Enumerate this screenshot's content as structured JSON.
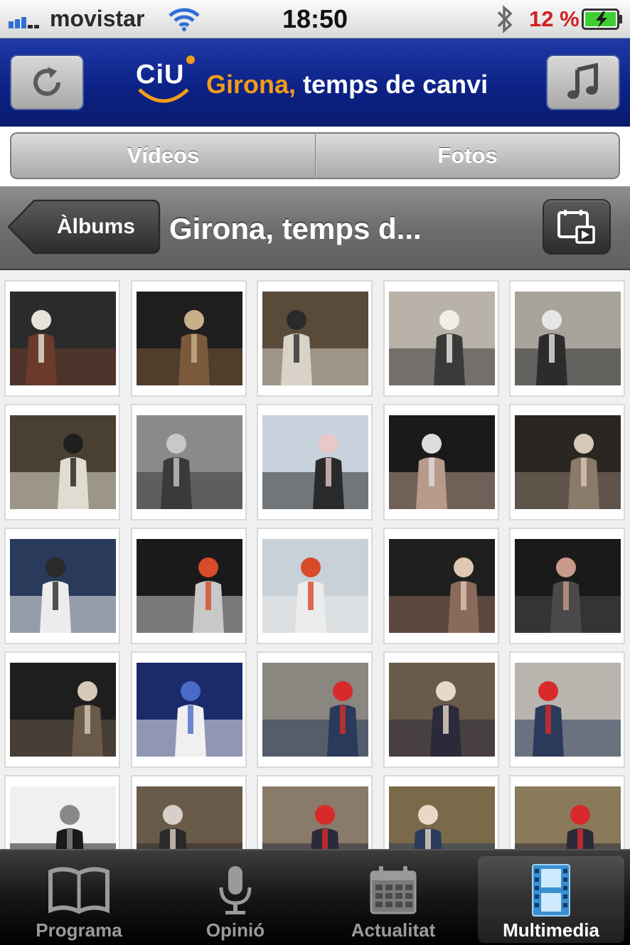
{
  "status_bar": {
    "carrier": "movistar",
    "time": "18:50",
    "battery_percent": "12 %"
  },
  "header": {
    "logo_text": "CiU",
    "title_accent": "Girona,",
    "title_rest": "temps de canvi"
  },
  "segments": {
    "videos": "Vídeos",
    "photos": "Fotos"
  },
  "navbar": {
    "back_label": "Àlbums",
    "title": "Girona, temps d..."
  },
  "tabs": [
    {
      "label": "Programa",
      "icon": "book-icon",
      "active": false
    },
    {
      "label": "Opinió",
      "icon": "microphone-icon",
      "active": false
    },
    {
      "label": "Actualitat",
      "icon": "calendar-icon",
      "active": false
    },
    {
      "label": "Multimedia",
      "icon": "film-icon",
      "active": true
    }
  ],
  "colors": {
    "header_blue": "#0c2286",
    "brand_orange": "#f39c1a",
    "battery_low": "#d21f1f",
    "active_tab_icon": "#6fb6ea"
  },
  "photo_count_visible": 25
}
